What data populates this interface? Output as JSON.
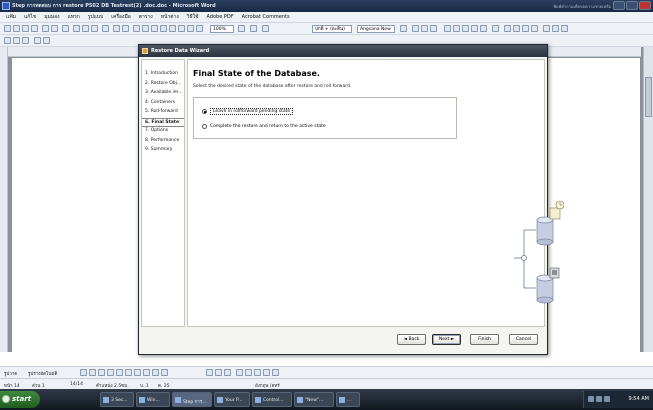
{
  "word": {
    "title": "Step การทดสอบ การ restore  P502 DB Testrest(2) .doc.doc - Microsoft Word",
    "title_hint": "พิมพ์คำถามเพื่อขอความช่วยเหลือ",
    "menu": [
      "แฟ้ม",
      "แก้ไข",
      "มุมมอง",
      "แทรก",
      "รูปแบบ",
      "เครื่องมือ",
      "ตาราง",
      "หน้าต่าง",
      "วิธีใช้",
      "Adobe PDF",
      "Acrobat Comments"
    ],
    "zoom": "100%",
    "style_box": "ปกติ + (ละติน)",
    "font_box": "Angsana New",
    "drawing_label": "รูปวาด",
    "autoshapes_label": "รูปร่างอัตโนมัติ",
    "status": {
      "page": "หน้า 14",
      "section": "ส่วน 1",
      "page_of": "14/14",
      "position": "ตำแหน่ง 2.5ซม.",
      "line": "บ. 1",
      "column": "ค. 25",
      "language": "อังกฤษ (สหรั"
    }
  },
  "taskbar": {
    "start_label": "start",
    "tasks": [
      "3 Sec...",
      "Win...",
      "Step การ...",
      "Your P...",
      "Control...",
      "\"New\"...",
      "..."
    ],
    "clock": "9:54 AM"
  },
  "wizard": {
    "title": "Restore Data Wizard",
    "steps": [
      "1. Introduction",
      "2. Restore Obj...",
      "3. Available im...",
      "4. Containers",
      "5. Roll-forward",
      "6. Final State",
      "7. Options",
      "8. Performance",
      "9. Summary"
    ],
    "current_step": "6. Final State",
    "heading": "Final State of the Database.",
    "description": "Select the desired state of the database after restore and roll forward.",
    "options": [
      {
        "label": "Leave in rollforward pending state",
        "selected": true
      },
      {
        "label": "Complete the restore and return to the active state",
        "selected": false
      }
    ],
    "buttons": {
      "back": "◄ Back",
      "next": "Next ►",
      "finish": "Finish",
      "cancel": "Cancel"
    }
  }
}
